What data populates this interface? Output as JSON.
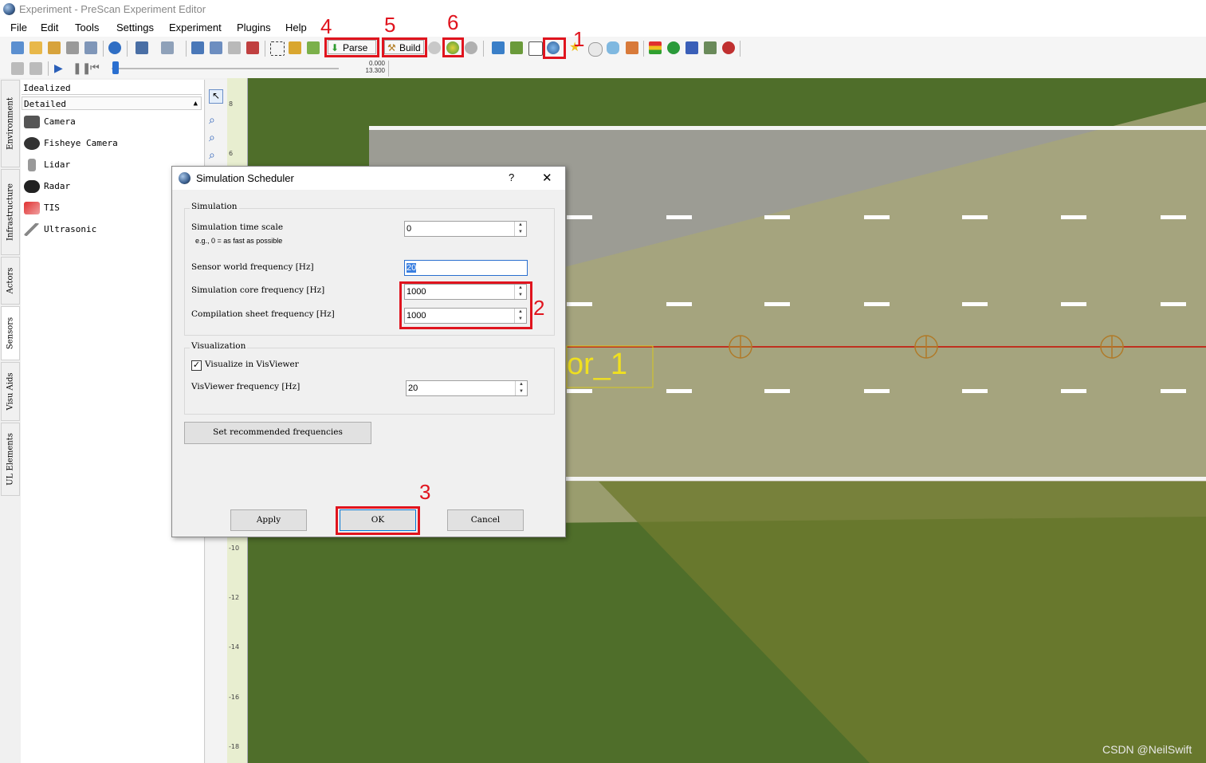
{
  "window": {
    "title": "Experiment - PreScan Experiment Editor"
  },
  "menu": [
    "File",
    "Edit",
    "Tools",
    "Settings",
    "Experiment",
    "Plugins",
    "Help"
  ],
  "toolbar": {
    "parse_label": "Parse",
    "build_label": "Build",
    "time_top": "0.000",
    "time_bottom": "13.300"
  },
  "annotations": [
    "1",
    "2",
    "3",
    "4",
    "5",
    "6"
  ],
  "vertical_tabs": [
    "Environment",
    "Infrastructure",
    "Actors",
    "Sensors",
    "Visu Aids",
    "UL Elements"
  ],
  "panel": {
    "header1": "Idealized",
    "header2": "Detailed",
    "items": [
      "Camera",
      "Fisheye Camera",
      "Lidar",
      "Radar",
      "TIS",
      "Ultrasonic"
    ]
  },
  "ruler": {
    "ticks": [
      "8",
      "6",
      "-10",
      "-12",
      "-14",
      "-16",
      "-18"
    ]
  },
  "scene": {
    "label": "or_1"
  },
  "dialog": {
    "title": "Simulation Scheduler",
    "help": "?",
    "close": "✕",
    "simulation_group": "Simulation",
    "time_scale_label": "Simulation time scale",
    "time_scale_hint": "e.g., 0 = as fast as possible",
    "time_scale_value": "0",
    "sensor_freq_label": "Sensor world frequency [Hz]",
    "sensor_freq_value": "20",
    "core_freq_label": "Simulation core frequency [Hz]",
    "core_freq_value": "1000",
    "compile_freq_label": "Compilation sheet frequency [Hz]",
    "compile_freq_value": "1000",
    "visualization_group": "Visualization",
    "visualize_label": "Visualize in VisViewer",
    "visviewer_freq_label": "VisViewer frequency [Hz]",
    "visviewer_freq_value": "20",
    "recommend_button": "Set recommended frequencies",
    "apply_button": "Apply",
    "ok_button": "OK",
    "cancel_button": "Cancel"
  },
  "watermark": "CSDN @NeilSwift"
}
